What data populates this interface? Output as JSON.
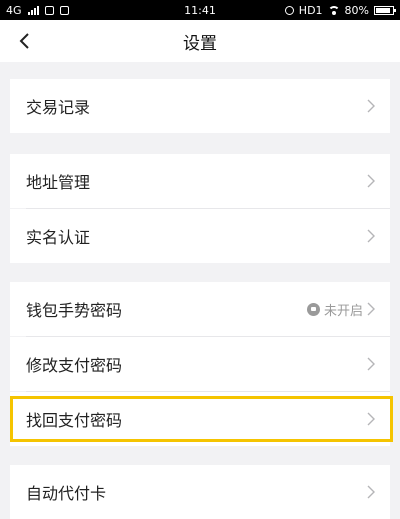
{
  "status_bar": {
    "network": "4G",
    "time": "11:41",
    "hd_label": "HD1",
    "battery": "80%"
  },
  "header": {
    "title": "设置",
    "back_icon": "chevron-left-icon"
  },
  "menu": {
    "items": [
      {
        "label": "交易记录"
      },
      {
        "label": "地址管理"
      },
      {
        "label": "实名认证"
      },
      {
        "label": "钱包手势密码",
        "status": "未开启"
      },
      {
        "label": "修改支付密码"
      },
      {
        "label": "找回支付密码",
        "highlighted": true
      },
      {
        "label": "自动代付卡"
      }
    ]
  },
  "colors": {
    "highlight": "#f5c400",
    "background": "#f2f2f4",
    "row": "#ffffff"
  }
}
